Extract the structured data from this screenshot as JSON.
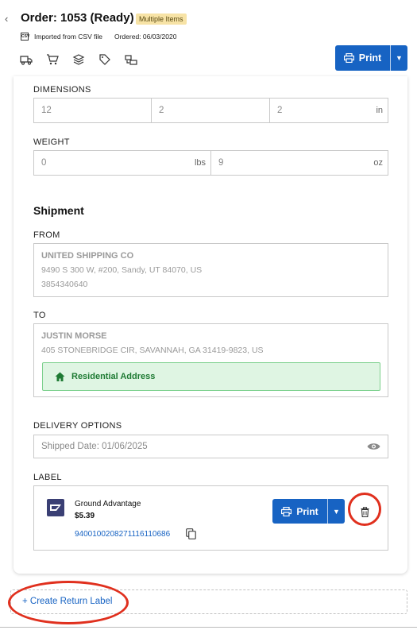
{
  "header": {
    "back_label": "‹",
    "order_title": "Order: 1053  (Ready)",
    "badge": "Multiple Items",
    "imported": "Imported from CSV file",
    "ordered": "Ordered: 06/03/2020",
    "csv_icon_text": "CSV",
    "toolbar_icons": [
      "truck-icon",
      "cart-icon",
      "layers-icon",
      "tag-icon",
      "product-swap-icon"
    ],
    "print_label": "Print"
  },
  "dimensions": {
    "label": "DIMENSIONS",
    "length": "12",
    "width": "2",
    "height": "2",
    "unit": "in"
  },
  "weight": {
    "label": "WEIGHT",
    "lbs_value": "0",
    "lbs_unit": "lbs",
    "oz_value": "9",
    "oz_unit": "oz"
  },
  "shipment": {
    "title": "Shipment",
    "from_label": "FROM",
    "from": {
      "name": "UNITED SHIPPING CO",
      "address": "9490 S 300 W, #200, Sandy, UT 84070, US",
      "phone": "3854340640"
    },
    "to_label": "TO",
    "to": {
      "name": "JUSTIN MORSE",
      "address": "405 STONEBRIDGE CIR, SAVANNAH, GA 31419-9823, US",
      "residential_label": "Residential Address"
    }
  },
  "delivery": {
    "label": "DELIVERY OPTIONS",
    "shipped_date": "Shipped Date: 01/06/2025"
  },
  "label_section": {
    "label": "LABEL",
    "service": "Ground Advantage",
    "price": "$5.39",
    "tracking": "9400100208271116110686",
    "print_label": "Print"
  },
  "return": {
    "link": "+ Create Return Label"
  },
  "colors": {
    "primary": "#1763c3",
    "annotation_red": "#e0301e",
    "residential_bg": "#dff5e3",
    "badge_bg": "#f7e3a6"
  }
}
